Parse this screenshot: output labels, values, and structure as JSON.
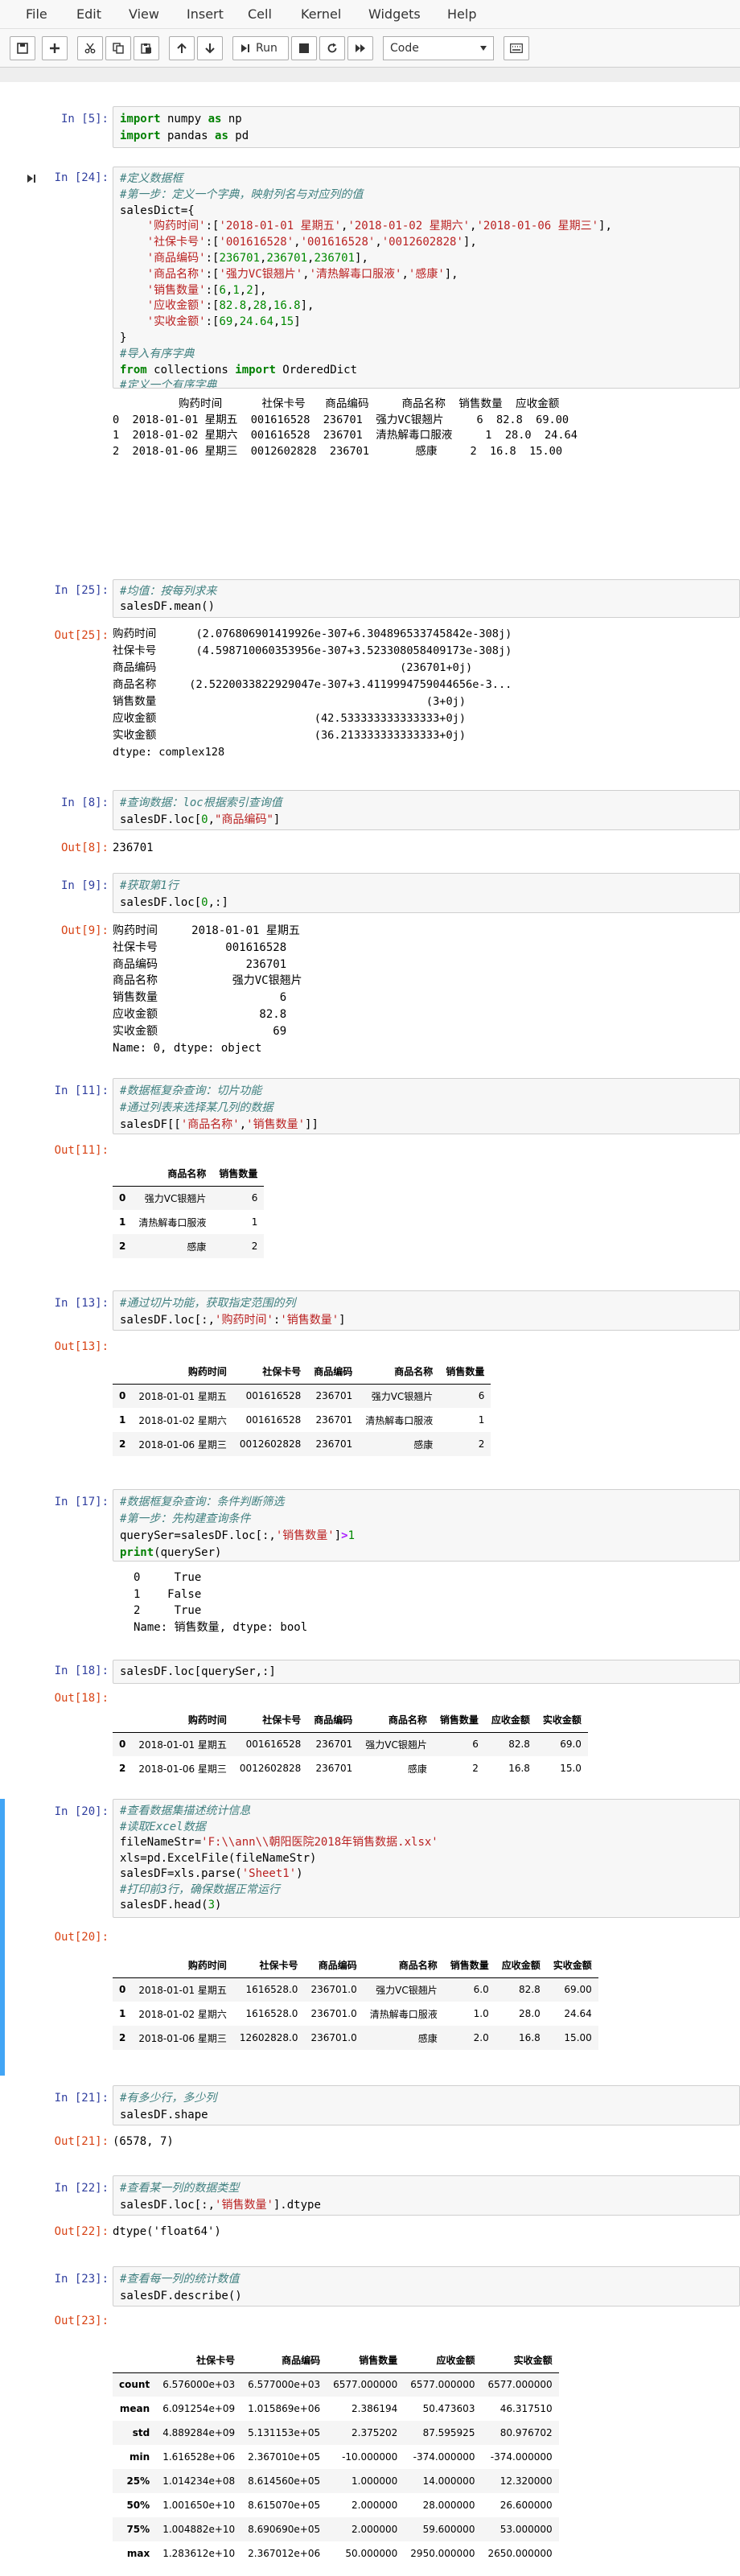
{
  "menu": [
    "File",
    "Edit",
    "View",
    "Insert",
    "Cell",
    "Kernel",
    "Widgets",
    "Help"
  ],
  "toolbar": {
    "run_label": "Run",
    "cell_type": "Code"
  },
  "cells": {
    "c1": {
      "prompt": "In [5]:"
    },
    "c2": {
      "prompt": "In [24]:",
      "output_lines": [
        "          购药时间      社保卡号   商品编码     商品名称  销售数量  应收金额",
        "0  2018-01-01 星期五  001616528  236701  强力VC银翘片     6  82.8  69.00",
        "1  2018-01-02 星期六  001616528  236701  清热解毒口服液     1  28.0  24.64",
        "2  2018-01-06 星期三  0012602828  236701       感康     2  16.8  15.00"
      ]
    },
    "c3": {
      "prompt": "In [25]:",
      "out_prompt": "Out[25]:",
      "output_lines": [
        "购药时间      (2.076806901419926e-307+6.304896533745842e-308j)",
        "社保卡号      (4.598710060353956e-307+3.523308058409173e-308j)",
        "商品编码                                     (236701+0j)",
        "商品名称     (2.5220033822929047e-307+3.4119994759044656e-3...",
        "销售数量                                         (3+0j)",
        "应收金额                        (42.533333333333333+0j)",
        "实收金额                        (36.213333333333333+0j)",
        "dtype: complex128"
      ]
    },
    "c4": {
      "prompt": "In [8]:",
      "out_prompt": "Out[8]:",
      "output": "236701"
    },
    "c5": {
      "prompt": "In [9]:",
      "out_prompt": "Out[9]:",
      "output_lines": [
        "购药时间     2018-01-01 星期五",
        "社保卡号          001616528",
        "商品编码             236701",
        "商品名称           强力VC银翘片",
        "销售数量                  6",
        "应收金额               82.8",
        "实收金额                 69",
        "Name: 0, dtype: object"
      ]
    },
    "c6": {
      "prompt": "In [11]:",
      "out_prompt": "Out[11]:",
      "table": {
        "headers": [
          "",
          "商品名称",
          "销售数量"
        ],
        "rows": [
          [
            "0",
            "强力VC银翘片",
            "6"
          ],
          [
            "1",
            "清热解毒口服液",
            "1"
          ],
          [
            "2",
            "感康",
            "2"
          ]
        ]
      }
    },
    "c7": {
      "prompt": "In [13]:",
      "out_prompt": "Out[13]:",
      "table": {
        "headers": [
          "",
          "购药时间",
          "社保卡号",
          "商品编码",
          "商品名称",
          "销售数量"
        ],
        "rows": [
          [
            "0",
            "2018-01-01 星期五",
            "001616528",
            "236701",
            "强力VC银翘片",
            "6"
          ],
          [
            "1",
            "2018-01-02 星期六",
            "001616528",
            "236701",
            "清热解毒口服液",
            "1"
          ],
          [
            "2",
            "2018-01-06 星期三",
            "0012602828",
            "236701",
            "感康",
            "2"
          ]
        ]
      }
    },
    "c8": {
      "prompt": "In [17]:",
      "output_lines": [
        "0     True",
        "1    False",
        "2     True",
        "Name: 销售数量, dtype: bool"
      ]
    },
    "c9": {
      "prompt": "In [18]:",
      "out_prompt": "Out[18]:",
      "table": {
        "headers": [
          "",
          "购药时间",
          "社保卡号",
          "商品编码",
          "商品名称",
          "销售数量",
          "应收金额",
          "实收金额"
        ],
        "rows": [
          [
            "0",
            "2018-01-01 星期五",
            "001616528",
            "236701",
            "强力VC银翘片",
            "6",
            "82.8",
            "69.0"
          ],
          [
            "2",
            "2018-01-06 星期三",
            "0012602828",
            "236701",
            "感康",
            "2",
            "16.8",
            "15.0"
          ]
        ]
      }
    },
    "c10": {
      "prompt": "In [20]:",
      "out_prompt": "Out[20]:",
      "table": {
        "headers": [
          "",
          "购药时间",
          "社保卡号",
          "商品编码",
          "商品名称",
          "销售数量",
          "应收金额",
          "实收金额"
        ],
        "rows": [
          [
            "0",
            "2018-01-01 星期五",
            "1616528.0",
            "236701.0",
            "强力VC银翘片",
            "6.0",
            "82.8",
            "69.00"
          ],
          [
            "1",
            "2018-01-02 星期六",
            "1616528.0",
            "236701.0",
            "清热解毒口服液",
            "1.0",
            "28.0",
            "24.64"
          ],
          [
            "2",
            "2018-01-06 星期三",
            "12602828.0",
            "236701.0",
            "感康",
            "2.0",
            "16.8",
            "15.00"
          ]
        ]
      }
    },
    "c11": {
      "prompt": "In [21]:",
      "out_prompt": "Out[21]:",
      "output": "(6578, 7)"
    },
    "c12": {
      "prompt": "In [22]:",
      "out_prompt": "Out[22]:",
      "output": "dtype('float64')"
    },
    "c13": {
      "prompt": "In [23]:",
      "out_prompt": "Out[23]:",
      "table": {
        "headers": [
          "",
          "社保卡号",
          "商品编码",
          "销售数量",
          "应收金额",
          "实收金额"
        ],
        "rows": [
          [
            "count",
            "6.576000e+03",
            "6.577000e+03",
            "6577.000000",
            "6577.000000",
            "6577.000000"
          ],
          [
            "mean",
            "6.091254e+09",
            "1.015869e+06",
            "2.386194",
            "50.473603",
            "46.317510"
          ],
          [
            "std",
            "4.889284e+09",
            "5.131153e+05",
            "2.375202",
            "87.595925",
            "80.976702"
          ],
          [
            "min",
            "1.616528e+06",
            "2.367010e+05",
            "-10.000000",
            "-374.000000",
            "-374.000000"
          ],
          [
            "25%",
            "1.014234e+08",
            "8.614560e+05",
            "1.000000",
            "14.000000",
            "12.320000"
          ],
          [
            "50%",
            "1.001650e+10",
            "8.615070e+05",
            "2.000000",
            "28.000000",
            "26.600000"
          ],
          [
            "75%",
            "1.004882e+10",
            "8.690690e+05",
            "2.000000",
            "59.600000",
            "53.000000"
          ],
          [
            "max",
            "1.283612e+10",
            "2.367012e+06",
            "50.000000",
            "2950.000000",
            "2650.000000"
          ]
        ]
      }
    }
  }
}
